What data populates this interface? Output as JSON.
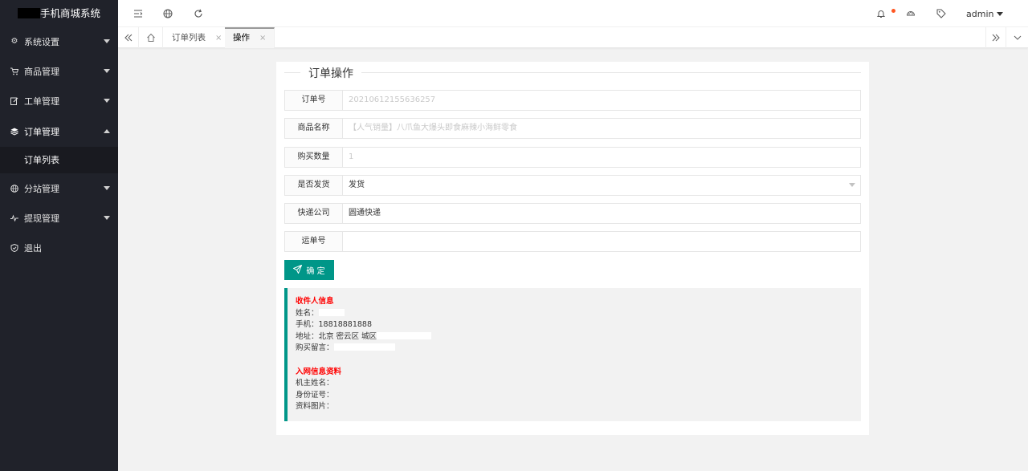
{
  "app": {
    "title_suffix": "手机商城系统"
  },
  "sidebar": {
    "items": [
      {
        "label": "系统设置",
        "icon": "gear-icon"
      },
      {
        "label": "商品管理",
        "icon": "cart-icon"
      },
      {
        "label": "工单管理",
        "icon": "edit-icon"
      },
      {
        "label": "订单管理",
        "icon": "box-icon"
      },
      {
        "label": "分站管理",
        "icon": "globe-icon"
      },
      {
        "label": "提现管理",
        "icon": "pulse-icon"
      },
      {
        "label": "退出",
        "icon": "shield-icon"
      }
    ],
    "submenu": [
      {
        "label": "订单列表"
      }
    ]
  },
  "header": {
    "user": "admin"
  },
  "tabs": [
    {
      "label": "订单列表"
    },
    {
      "label": "操作"
    }
  ],
  "form": {
    "title": "订单操作",
    "fields": [
      {
        "label": "订单号",
        "value": "20210612155636257"
      },
      {
        "label": "商品名称",
        "value": "【人气销量】八爪鱼大爆头即食麻辣小海鲜零食"
      },
      {
        "label": "购买数量",
        "value": "1"
      },
      {
        "label": "是否发货",
        "value": "发货"
      },
      {
        "label": "快递公司",
        "value": "圆通快递"
      },
      {
        "label": "运单号",
        "value": ""
      }
    ],
    "submit_label": "确 定"
  },
  "info": {
    "recipient_title": "收件人信息",
    "name_label": "姓名：",
    "phone_label": "手机：",
    "phone": "18818881888",
    "address_label": "地址：",
    "address": "北京 密云区 城区",
    "remark_label": "购买留言：",
    "netin_title": "入网信息资料",
    "owner_label": "机主姓名：",
    "idcard_label": "身份证号：",
    "photo_label": "资料图片："
  }
}
